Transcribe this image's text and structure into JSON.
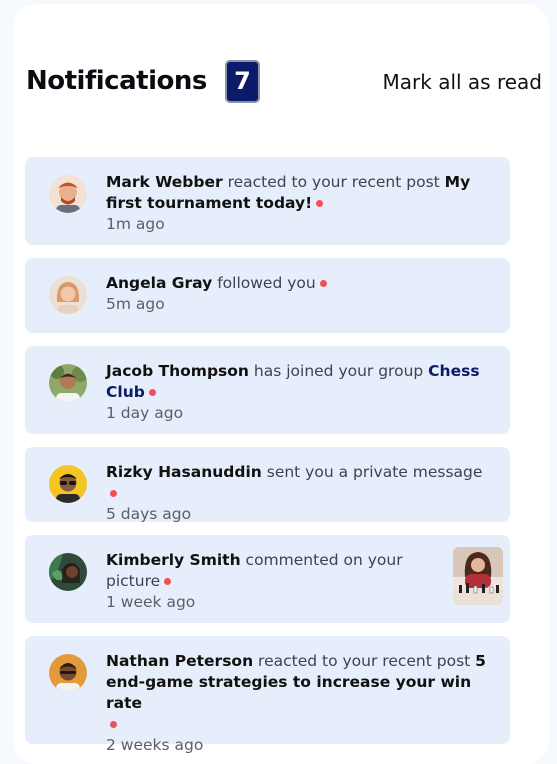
{
  "header": {
    "title": "Notifications",
    "unread_count": "7",
    "mark_all_label": "Mark all as read"
  },
  "notifications": [
    {
      "name": "Mark Webber",
      "action": " reacted to your recent post ",
      "target": "My first tournament today!",
      "time": "1m ago",
      "avatar": "avatar-mark-webber"
    },
    {
      "name": "Angela Gray",
      "action": " followed you",
      "time": "5m ago",
      "avatar": "avatar-angela-gray"
    },
    {
      "name": "Jacob Thompson",
      "action": " has joined your group ",
      "target": "Chess Club",
      "time": "1 day ago",
      "avatar": "avatar-jacob-thompson"
    },
    {
      "name": "Rizky Hasanuddin",
      "action": " sent you a private message",
      "time": "5 days ago",
      "avatar": "avatar-rizky-hasanuddin"
    },
    {
      "name": "Kimberly Smith",
      "action": " commented on your picture",
      "time": "1 week ago",
      "avatar": "avatar-kimberly-smith",
      "thumbnail": "chess-picture-thumbnail"
    },
    {
      "name": "Nathan Peterson",
      "action": " reacted to your recent post ",
      "target": "5 end-game strategies to increase your win rate",
      "time": "2 weeks ago",
      "avatar": "avatar-nathan-peterson"
    }
  ],
  "colors": {
    "badge": "#0c1a6a",
    "unread_dot": "#f0505a",
    "item_background": "#e5eefa",
    "group_link": "#0c1a6a"
  }
}
